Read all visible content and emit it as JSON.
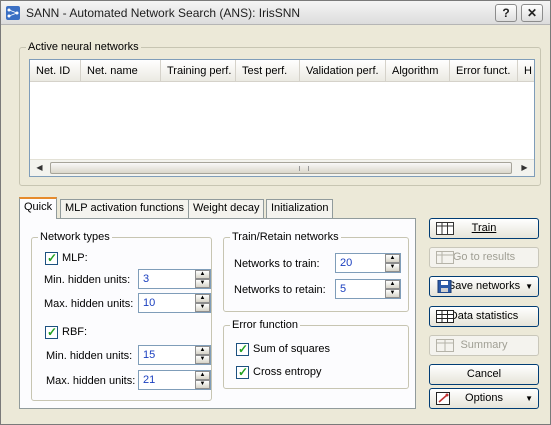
{
  "window": {
    "title": "SANN - Automated Network Search (ANS): IrisSNN",
    "help_glyph": "?",
    "close_glyph": "✕"
  },
  "networks_group": {
    "label": "Active neural networks",
    "columns": [
      "Net. ID",
      "Net. name",
      "Training perf.",
      "Test perf.",
      "Validation perf.",
      "Algorithm",
      "Error funct.",
      "H"
    ],
    "rows": []
  },
  "tabs": [
    {
      "label": "Quick",
      "active": true
    },
    {
      "label": "MLP activation functions",
      "active": false
    },
    {
      "label": "Weight decay",
      "active": false
    },
    {
      "label": "Initialization",
      "active": false
    }
  ],
  "network_types": {
    "label": "Network types",
    "mlp": {
      "label": "MLP:",
      "checked": true
    },
    "mlp_min": {
      "label": "Min. hidden units:",
      "value": "3"
    },
    "mlp_max": {
      "label": "Max. hidden units:",
      "value": "10"
    },
    "rbf": {
      "label": "RBF:",
      "checked": true
    },
    "rbf_min": {
      "label": "Min. hidden units:",
      "value": "15"
    },
    "rbf_max": {
      "label": "Max. hidden units:",
      "value": "21"
    }
  },
  "train_retain": {
    "label": "Train/Retain networks",
    "to_train": {
      "label": "Networks to train:",
      "value": "20"
    },
    "to_retain": {
      "label": "Networks to retain:",
      "value": "5"
    }
  },
  "error_function": {
    "label": "Error function",
    "sum_of_squares": {
      "label": "Sum of squares",
      "checked": true
    },
    "cross_entropy": {
      "label": "Cross entropy",
      "checked": true
    }
  },
  "buttons": {
    "train": "Train",
    "go_to_results": "Go to results",
    "save_networks": "Save networks",
    "data_statistics": "Data statistics",
    "summary": "Summary",
    "cancel": "Cancel",
    "options": "Options"
  },
  "colors": {
    "window_bg": "#ece9d8",
    "value_text": "#1a3fbf",
    "active_tab_accent": "#e68b2c",
    "checkmark": "#21a121"
  }
}
